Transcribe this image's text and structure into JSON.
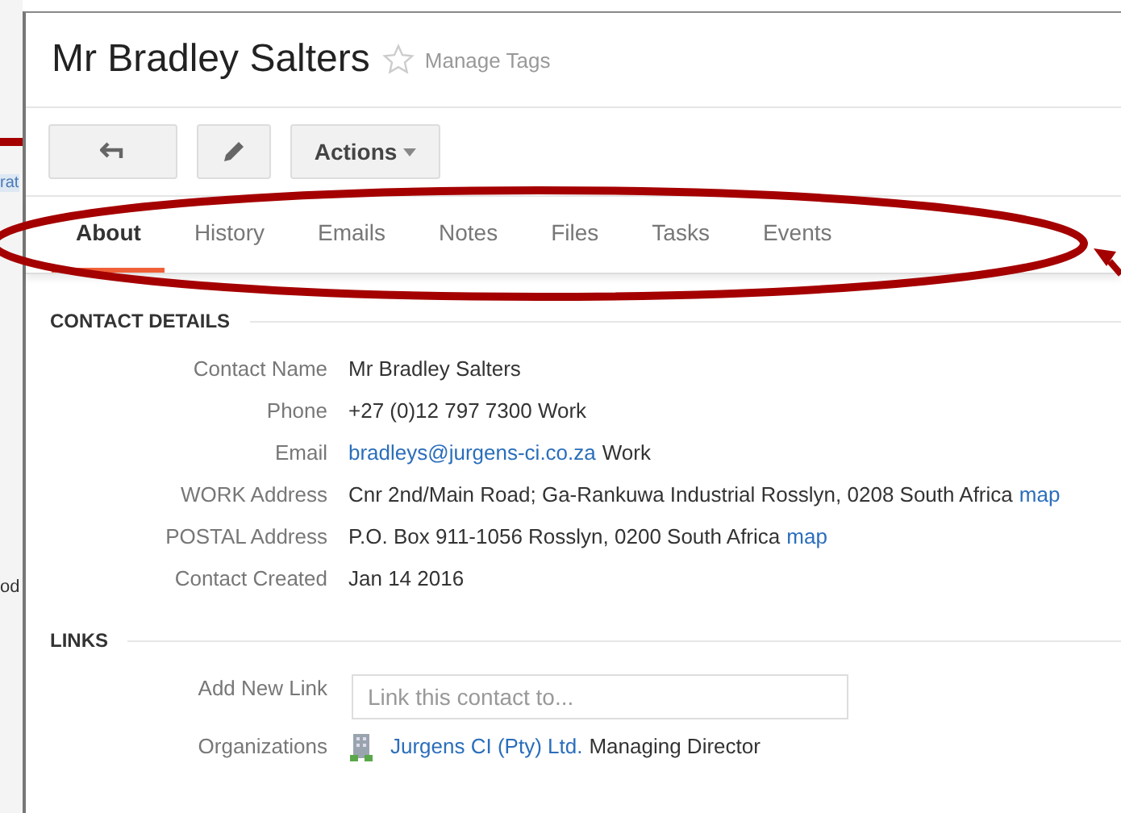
{
  "background": {
    "fragments": [
      "rat",
      "od"
    ]
  },
  "contact": {
    "title": "Mr Bradley Salters",
    "starred": false,
    "manage_tags": "Manage Tags"
  },
  "toolbar": {
    "actions": "Actions"
  },
  "tabs": [
    {
      "label": "About",
      "selected": true
    },
    {
      "label": "History",
      "selected": false
    },
    {
      "label": "Emails",
      "selected": false
    },
    {
      "label": "Notes",
      "selected": false
    },
    {
      "label": "Files",
      "selected": false
    },
    {
      "label": "Tasks",
      "selected": false
    },
    {
      "label": "Events",
      "selected": false
    }
  ],
  "contact_details": {
    "heading": "CONTACT DETAILS",
    "rows": [
      {
        "label": "Contact Name",
        "parts": [
          {
            "kind": "text",
            "text": "Mr Bradley Salters"
          }
        ]
      },
      {
        "label": "Phone",
        "parts": [
          {
            "kind": "text",
            "text": "+27 (0)12 797 7300 Work"
          }
        ]
      },
      {
        "label": "Email",
        "parts": [
          {
            "kind": "link",
            "text": "bradleys@jurgens-ci.co.za"
          },
          {
            "kind": "text",
            "text": "Work"
          }
        ]
      },
      {
        "label": "WORK Address",
        "parts": [
          {
            "kind": "text",
            "text": "Cnr 2nd/Main Road; Ga-Rankuwa Industrial Rosslyn, 0208 South Africa"
          },
          {
            "kind": "link",
            "text": "map"
          }
        ]
      },
      {
        "label": "POSTAL Address",
        "parts": [
          {
            "kind": "text",
            "text": "P.O. Box 911-1056 Rosslyn, 0200 South Africa"
          },
          {
            "kind": "link",
            "text": "map"
          }
        ]
      },
      {
        "label": "Contact Created",
        "parts": [
          {
            "kind": "text",
            "text": "Jan 14 2016"
          }
        ]
      }
    ]
  },
  "links": {
    "heading": "LINKS",
    "add_label": "Add New Link",
    "placeholder": "Link this contact to...",
    "org_label": "Organizations",
    "org_name": "Jurgens CI (Pty) Ltd.",
    "org_role": "Managing Director"
  }
}
